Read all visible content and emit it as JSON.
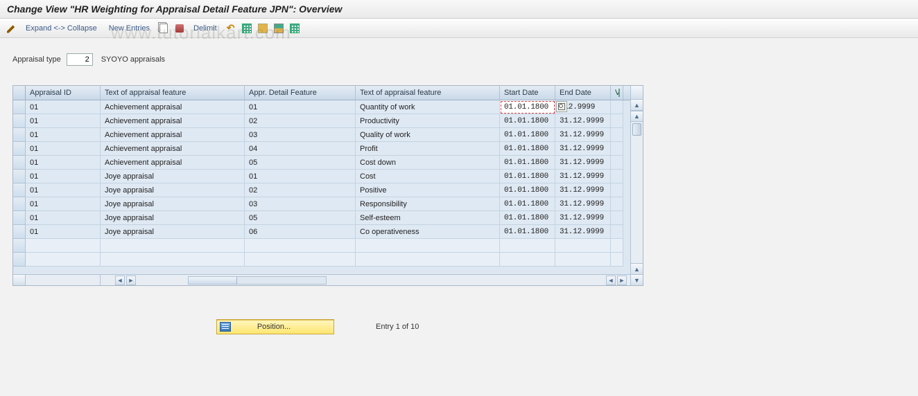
{
  "title": "Change View \"HR Weighting for Appraisal Detail Feature JPN\": Overview",
  "watermark": "www.tutorialkart.com",
  "toolbar": {
    "expand": "Expand <-> Collapse",
    "new_entries": "New Entries",
    "delimit": "Delimit"
  },
  "filter": {
    "label": "Appraisal type",
    "value": "2",
    "desc": "SYOYO  appraisals"
  },
  "columns": {
    "c1": "Appraisal ID",
    "c2": "Text of appraisal feature",
    "c3": "Appr. Detail Feature",
    "c4": "Text of appraisal feature",
    "c5": "Start Date",
    "c6": "End Date",
    "c7": "V"
  },
  "rows": [
    {
      "id": "01",
      "t1": "Achievement appraisal",
      "df": "01",
      "t2": "Quantity of work",
      "sd": "01.01.1800",
      "ed": "31.12.9999"
    },
    {
      "id": "01",
      "t1": "Achievement appraisal",
      "df": "02",
      "t2": "Productivity",
      "sd": "01.01.1800",
      "ed": "31.12.9999"
    },
    {
      "id": "01",
      "t1": "Achievement appraisal",
      "df": "03",
      "t2": "Quality of work",
      "sd": "01.01.1800",
      "ed": "31.12.9999"
    },
    {
      "id": "01",
      "t1": "Achievement appraisal",
      "df": "04",
      "t2": "Profit",
      "sd": "01.01.1800",
      "ed": "31.12.9999"
    },
    {
      "id": "01",
      "t1": "Achievement appraisal",
      "df": "05",
      "t2": "Cost down",
      "sd": "01.01.1800",
      "ed": "31.12.9999"
    },
    {
      "id": "01",
      "t1": "Joye appraisal",
      "df": "01",
      "t2": "Cost",
      "sd": "01.01.1800",
      "ed": "31.12.9999"
    },
    {
      "id": "01",
      "t1": "Joye appraisal",
      "df": "02",
      "t2": "Positive",
      "sd": "01.01.1800",
      "ed": "31.12.9999"
    },
    {
      "id": "01",
      "t1": "Joye appraisal",
      "df": "03",
      "t2": "Responsibility",
      "sd": "01.01.1800",
      "ed": "31.12.9999"
    },
    {
      "id": "01",
      "t1": "Joye appraisal",
      "df": "05",
      "t2": "Self-esteem",
      "sd": "01.01.1800",
      "ed": "31.12.9999"
    },
    {
      "id": "01",
      "t1": "Joye appraisal",
      "df": "06",
      "t2": "Co operativeness",
      "sd": "01.01.1800",
      "ed": "31.12.9999"
    }
  ],
  "selected_end_partial": ".12.9999",
  "footer": {
    "position_btn": "Position...",
    "entry_text": "Entry 1 of 10"
  }
}
